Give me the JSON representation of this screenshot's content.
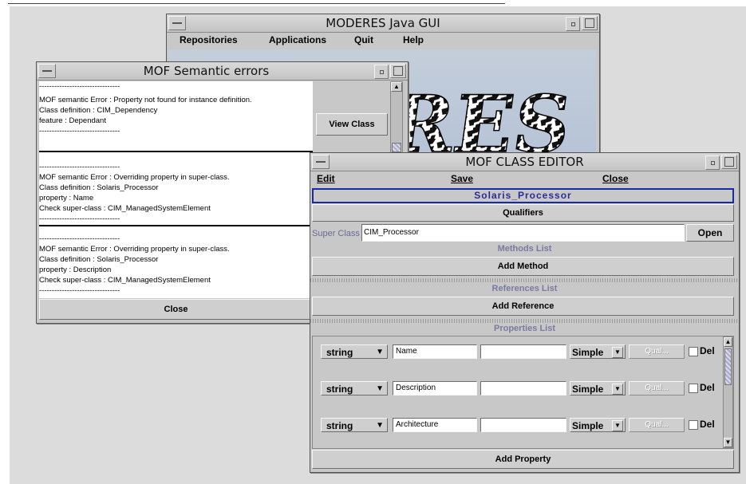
{
  "main_window": {
    "title": "MODERES Java GUI",
    "menu": [
      "Repositories",
      "Applications",
      "Quit",
      "Help"
    ],
    "logo_text": "RES"
  },
  "errors_window": {
    "title": "MOF Semantic errors",
    "view_class_label": "View Class",
    "close_label": "Close",
    "separator": "--------------------------------",
    "errors": [
      {
        "lines": [
          "MOF semantic Error : Property not found for instance definition.",
          "   Class definition : CIM_Dependency",
          "   feature : Dependant"
        ]
      },
      {
        "lines": [
          "MOF semantic Error : Overriding property in super-class.",
          "   Class definition : Solaris_Processor",
          "   property : Name",
          "Check super-class : CIM_ManagedSystemElement"
        ]
      },
      {
        "lines": [
          "MOF semantic Error : Overriding property in super-class.",
          "   Class definition : Solaris_Processor",
          "   property : Description",
          "Check super-class : CIM_ManagedSystemElement"
        ]
      }
    ]
  },
  "class_editor": {
    "title": "MOF CLASS EDITOR",
    "menu": {
      "edit": "Edit",
      "save": "Save",
      "close": "Close"
    },
    "class_name": "Solaris_Processor",
    "qualifiers_label": "Qualifiers",
    "super_class_label": "Super Class",
    "super_class_value": "CIM_Processor",
    "open_label": "Open",
    "methods_list_label": "Methods List",
    "add_method_label": "Add Method",
    "references_list_label": "References List",
    "add_reference_label": "Add Reference",
    "properties_list_label": "Properties List",
    "add_property_label": "Add Property",
    "properties": [
      {
        "type": "string",
        "name": "Name",
        "value": "",
        "kind": "Simple",
        "qual": "Qual...",
        "del": "Del"
      },
      {
        "type": "string",
        "name": "Description",
        "value": "",
        "kind": "Simple",
        "qual": "Qual...",
        "del": "Del"
      },
      {
        "type": "string",
        "name": "Architecture",
        "value": "",
        "kind": "Simple",
        "qual": "Qual...",
        "del": "Del"
      }
    ]
  },
  "colors": {
    "window_bg": "#c8c8c8",
    "class_name_color": "#2a2a9a",
    "section_label_color": "#7a7aa0",
    "highlight_border": "#1a2aa0"
  }
}
